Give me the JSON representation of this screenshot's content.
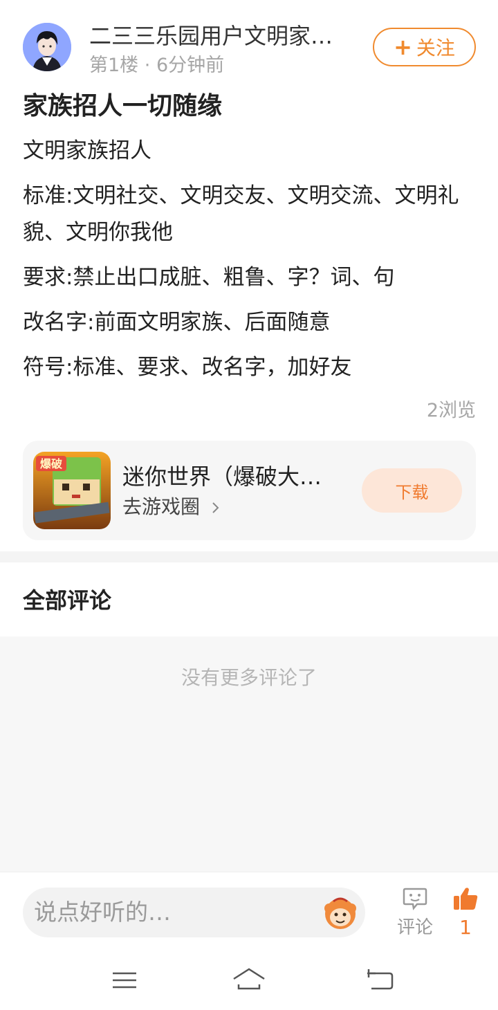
{
  "header": {
    "username": "二三三乐园用户文明家…",
    "floor": "第1楼",
    "dot": "·",
    "time": "6分钟前",
    "follow_label": "关注"
  },
  "post": {
    "title": "家族招人一切随缘",
    "paragraphs": [
      "文明家族招人",
      "标准:文明社交、文明交友、文明交流、文明礼貌、文明你我他",
      "要求:禁止出口成脏、粗鲁、字？词、句",
      "改名字:前面文明家族、后面随意",
      "符号:标准、要求、改名字，加好友"
    ],
    "views": "2浏览"
  },
  "game_card": {
    "name": "迷你世界（爆破大…",
    "link": "去游戏圈",
    "download_label": "下载",
    "icon_text": "爆破"
  },
  "comments": {
    "header": "全部评论",
    "empty_text": "没有更多评论了"
  },
  "bottom_bar": {
    "input_placeholder": "说点好听的…",
    "comment_label": "评论",
    "like_count": "1"
  },
  "colors": {
    "accent": "#f08a2e",
    "muted": "#a6a6a6"
  }
}
